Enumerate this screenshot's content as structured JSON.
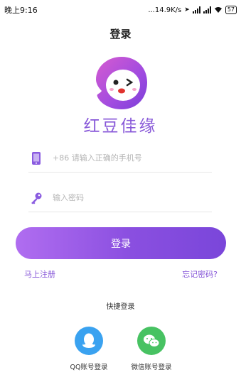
{
  "status_bar": {
    "time": "晚上9:16",
    "network_speed": "...14.9K/s",
    "battery": "57"
  },
  "header": {
    "title": "登录"
  },
  "brand": {
    "app_name": "红豆佳缘",
    "logo_icon": "smiley-blob-logo"
  },
  "form": {
    "phone": {
      "icon": "phone-icon",
      "value": "",
      "placeholder": "+86 请输入正确的手机号"
    },
    "password": {
      "icon": "key-icon",
      "value": "",
      "placeholder": "输入密码"
    },
    "login_label": "登录"
  },
  "links": {
    "register": "马上注册",
    "forgot": "忘记密码?"
  },
  "quick_login": {
    "title": "快捷登录",
    "options": [
      {
        "label": "QQ账号登录",
        "icon": "qq-icon",
        "color": "#3aa2f0"
      },
      {
        "label": "微信账号登录",
        "icon": "wechat-icon",
        "color": "#47c262"
      }
    ]
  },
  "colors": {
    "accent": "#8757d8",
    "button_start": "#b06df0",
    "button_end": "#7a46da"
  }
}
